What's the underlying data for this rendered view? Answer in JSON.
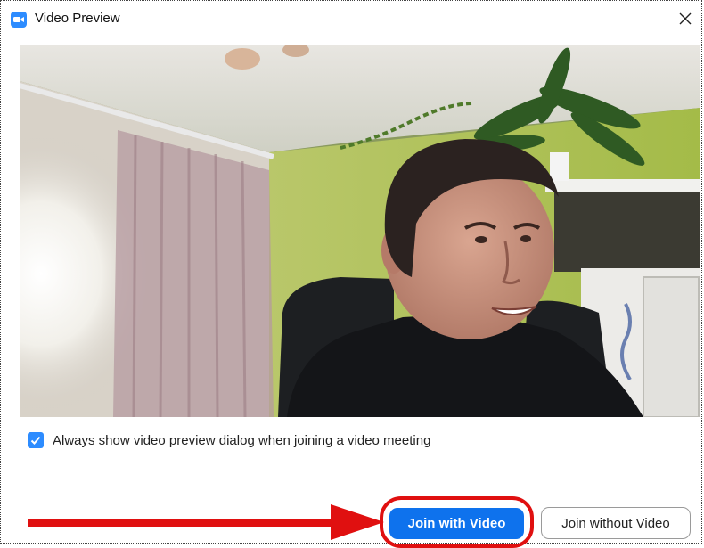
{
  "window": {
    "title": "Video Preview",
    "close_symbol": "✕",
    "icon": "zoom-video-icon"
  },
  "preview": {
    "option_label": "Always show video preview dialog when joining a video meeting",
    "option_checked": true
  },
  "buttons": {
    "join_with_video": "Join with Video",
    "join_without_video": "Join without Video"
  },
  "colors": {
    "accent": "#0e72ed",
    "checkbox": "#2d8cff",
    "annotation": "#e01010"
  }
}
